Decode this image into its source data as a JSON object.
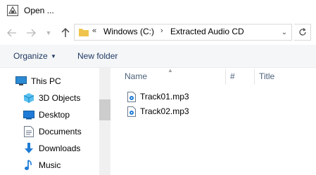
{
  "window": {
    "title": "Open ..."
  },
  "address_bar": {
    "overflow": "«",
    "breadcrumbs": [
      "Windows (C:)",
      "Extracted Audio CD"
    ]
  },
  "toolbar": {
    "organize_label": "Organize",
    "new_folder_label": "New folder"
  },
  "nav_pane": {
    "items": [
      {
        "label": "This PC",
        "icon": "this-pc-icon"
      },
      {
        "label": "3D Objects",
        "icon": "3d-objects-icon"
      },
      {
        "label": "Desktop",
        "icon": "desktop-icon"
      },
      {
        "label": "Documents",
        "icon": "documents-icon"
      },
      {
        "label": "Downloads",
        "icon": "downloads-icon"
      },
      {
        "label": "Music",
        "icon": "music-icon"
      }
    ]
  },
  "file_list": {
    "columns": [
      "Name",
      "#",
      "Title"
    ],
    "files": [
      {
        "name": "Track01.mp3",
        "icon": "audio-file-icon"
      },
      {
        "name": "Track02.mp3",
        "icon": "audio-file-icon"
      }
    ]
  },
  "colors": {
    "toolbar_text": "#1e3963",
    "header_text": "#4c607a",
    "folder": "#f0c44c",
    "accent": "#1f7bd6"
  }
}
